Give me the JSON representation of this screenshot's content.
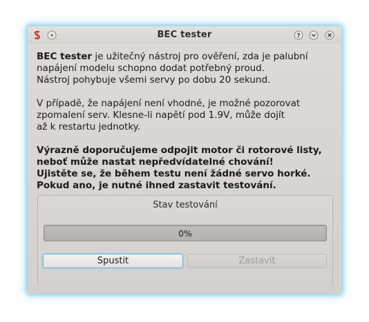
{
  "window": {
    "title": "BEC tester"
  },
  "intro": {
    "bold_name": "BEC tester",
    "line1_rest": " je užitečný nástroj pro ověření, zda je palubní",
    "line2": "napájení modelu schopno dodat potřebný proud.",
    "line3": "Nástroj pohybuje všemi servy po dobu 20 sekund."
  },
  "info": {
    "line1": "V případě, že napájení není vhodné, je možné pozorovat",
    "line2": "zpomalení serv. Klesne-li napětí pod 1.9V, může dojít",
    "line3": "až k restartu jednotky."
  },
  "warning": {
    "line1": "Výrazně doporučujeme odpojit motor či rotorové listy,",
    "line2": "neboť může nastat nepředvídatelné chování!",
    "line3": "Ujistěte se, že během testu není žádné servo horké.",
    "line4": "Pokud ano, je nutné ihned zastavit testování."
  },
  "status_group": {
    "title": "Stav testování",
    "progress_text": "0%",
    "progress_value": 0
  },
  "buttons": {
    "start_label": "Spustit",
    "stop_label": "Zastavit"
  },
  "colors": {
    "focus_glow": "#6fb3df",
    "app_icon": "#d0302a"
  }
}
